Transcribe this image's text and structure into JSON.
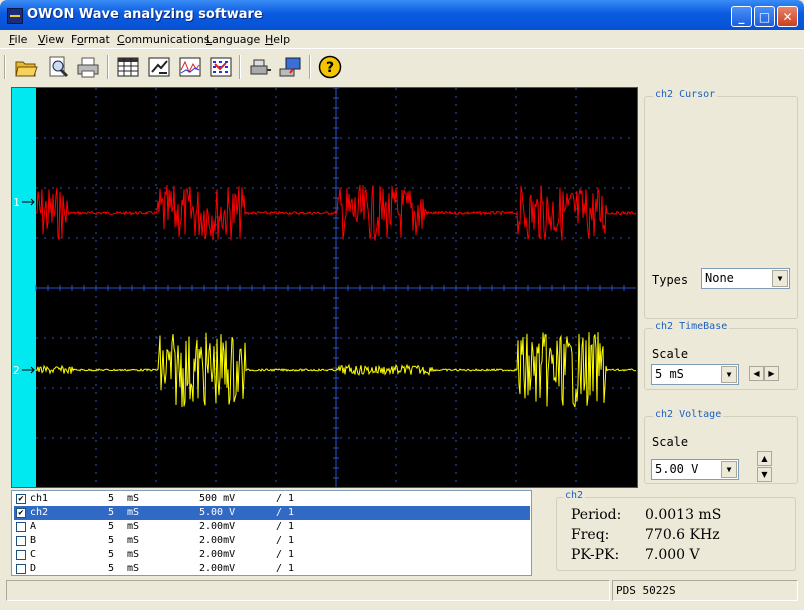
{
  "window": {
    "title": "OWON Wave analyzing software",
    "buttons": [
      "_",
      "□",
      "✕"
    ]
  },
  "menu": [
    "File",
    "View",
    "Format",
    "Communications",
    "Language",
    "Help"
  ],
  "menu_accel": [
    "F",
    "V",
    "o",
    "C",
    "L",
    "H"
  ],
  "toolbar": {
    "groups": [
      [
        "open-icon",
        "print-preview-icon",
        "print-icon"
      ],
      [
        "data-table-icon",
        "export-icon",
        "waveform-icon",
        "multi-waveform-icon"
      ],
      [
        "connect-icon",
        "usb-transfer-icon"
      ],
      [
        "help-icon"
      ]
    ]
  },
  "scope": {
    "ch1_marker": "1",
    "ch2_marker": "2",
    "ch1_color": "#ff0000",
    "ch2_color": "#ffff00",
    "trigger_bar_color": "#00e8f0",
    "grid_color": "#2a55c8"
  },
  "cursor_panel": {
    "title": "ch2 Cursor",
    "types_label": "Types",
    "types_value": "None"
  },
  "timebase_panel": {
    "title": "ch2 TimeBase",
    "scale_label": "Scale",
    "scale_value": "5  mS"
  },
  "voltage_panel": {
    "title": "ch2 Voltage",
    "scale_label": "Scale",
    "scale_value": "5.00 V"
  },
  "channels": [
    {
      "checked": true,
      "name": "ch1",
      "time": "5",
      "unit": "mS",
      "volt": "500 mV",
      "probe": "/ 1",
      "selected": false
    },
    {
      "checked": true,
      "name": "ch2",
      "time": "5",
      "unit": "mS",
      "volt": "5.00 V",
      "probe": "/ 1",
      "selected": true
    },
    {
      "checked": false,
      "name": "A",
      "time": "5",
      "unit": "mS",
      "volt": "2.00mV",
      "probe": "/ 1",
      "selected": false
    },
    {
      "checked": false,
      "name": "B",
      "time": "5",
      "unit": "mS",
      "volt": "2.00mV",
      "probe": "/ 1",
      "selected": false
    },
    {
      "checked": false,
      "name": "C",
      "time": "5",
      "unit": "mS",
      "volt": "2.00mV",
      "probe": "/ 1",
      "selected": false
    },
    {
      "checked": false,
      "name": "D",
      "time": "5",
      "unit": "mS",
      "volt": "2.00mV",
      "probe": "/ 1",
      "selected": false
    }
  ],
  "measurements": {
    "title": "ch2",
    "period_label": "Period:",
    "period_value": "0.0013 mS",
    "freq_label": "Freq:",
    "freq_value": "770.6 KHz",
    "pkpk_label": "PK-PK:",
    "pkpk_value": "7.000 V"
  },
  "status": {
    "model": "PDS 5022S"
  }
}
